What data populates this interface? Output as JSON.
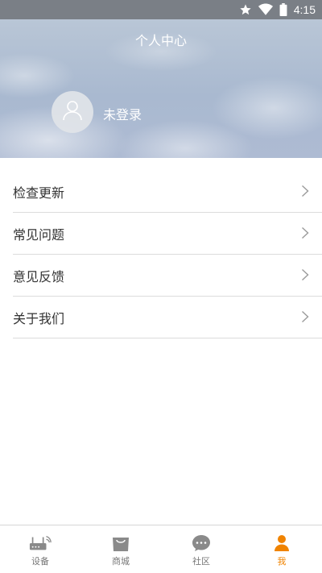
{
  "status_bar": {
    "time": "4:15",
    "icons": [
      "star-icon",
      "wifi-icon",
      "battery-icon"
    ]
  },
  "header": {
    "title": "个人中心",
    "avatar_icon": "user-icon",
    "login_status": "未登录"
  },
  "menu": {
    "items": [
      {
        "label": "检查更新",
        "icon": "chevron-right-icon"
      },
      {
        "label": "常见问题",
        "icon": "chevron-right-icon"
      },
      {
        "label": "意见反馈",
        "icon": "chevron-right-icon"
      },
      {
        "label": "关于我们",
        "icon": "chevron-right-icon"
      }
    ]
  },
  "bottom_nav": {
    "items": [
      {
        "label": "设备",
        "icon": "router-icon",
        "active": false
      },
      {
        "label": "商城",
        "icon": "shop-bag-icon",
        "active": false
      },
      {
        "label": "社区",
        "icon": "chat-bubble-icon",
        "active": false
      },
      {
        "label": "我",
        "icon": "person-icon",
        "active": true
      }
    ]
  },
  "colors": {
    "accent": "#f08300",
    "inactive": "#777777",
    "status_bar": "#7a7f86"
  }
}
